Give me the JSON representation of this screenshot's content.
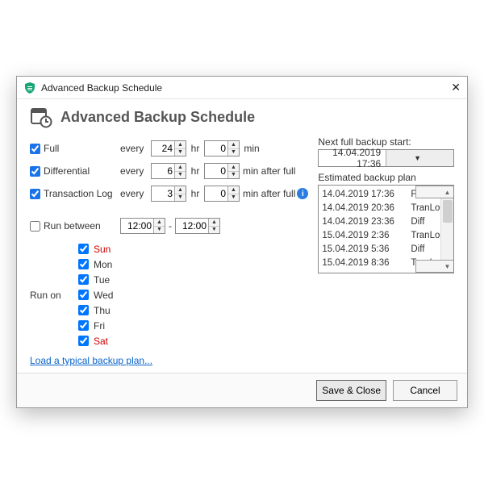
{
  "window": {
    "title": "Advanced Backup Schedule"
  },
  "header": {
    "title": "Advanced Backup Schedule"
  },
  "schedule": {
    "every_label": "every",
    "hr_label": "hr",
    "min_label": "min",
    "after_full_label": "min  after full",
    "full": {
      "label": "Full",
      "checked": true,
      "hr": "24",
      "min": "0"
    },
    "diff": {
      "label": "Differential",
      "checked": true,
      "hr": "6",
      "min": "0"
    },
    "tlog": {
      "label": "Transaction Log",
      "checked": true,
      "hr": "3",
      "min": "0"
    }
  },
  "run_between": {
    "label": "Run between",
    "checked": false,
    "from": "12:00",
    "to": "12:00",
    "dash": "-"
  },
  "run_on": {
    "label": "Run on",
    "days": [
      {
        "key": "sun",
        "label": "Sun",
        "checked": true
      },
      {
        "key": "mon",
        "label": "Mon",
        "checked": true
      },
      {
        "key": "tue",
        "label": "Tue",
        "checked": true
      },
      {
        "key": "wed",
        "label": "Wed",
        "checked": true
      },
      {
        "key": "thu",
        "label": "Thu",
        "checked": true
      },
      {
        "key": "fri",
        "label": "Fri",
        "checked": true
      },
      {
        "key": "sat",
        "label": "Sat",
        "checked": true
      }
    ]
  },
  "link": {
    "label": "Load a typical backup plan..."
  },
  "next_start": {
    "label": "Next full backup start:",
    "value": "14.04.2019 17:36"
  },
  "plan": {
    "label": "Estimated backup plan",
    "rows": [
      {
        "date": "14.04.2019 17:36",
        "type": "Full"
      },
      {
        "date": "14.04.2019 20:36",
        "type": "TranLog"
      },
      {
        "date": "14.04.2019 23:36",
        "type": "Diff"
      },
      {
        "date": "15.04.2019 2:36",
        "type": "TranLog"
      },
      {
        "date": "15.04.2019 5:36",
        "type": "Diff"
      },
      {
        "date": "15.04.2019 8:36",
        "type": "TranLog"
      }
    ]
  },
  "footer": {
    "save": "Save & Close",
    "cancel": "Cancel"
  }
}
